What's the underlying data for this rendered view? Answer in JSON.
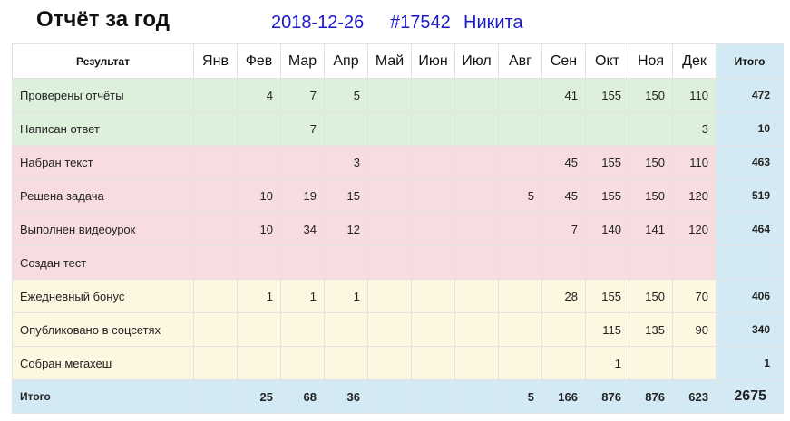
{
  "header": {
    "title": "Отчёт за год",
    "date": "2018-12-26",
    "id": "#17542",
    "user": "Никита"
  },
  "table": {
    "result_header": "Результат",
    "months": [
      "Янв",
      "Фев",
      "Мар",
      "Апр",
      "Май",
      "Июн",
      "Июл",
      "Авг",
      "Сен",
      "Окт",
      "Ноя",
      "Дек"
    ],
    "total_header": "Итого",
    "rows": [
      {
        "group": "green",
        "label": "Проверены отчёты",
        "values": [
          "",
          "4",
          "7",
          "5",
          "",
          "",
          "",
          "",
          "41",
          "155",
          "150",
          "110"
        ],
        "total": "472"
      },
      {
        "group": "green",
        "label": "Написан ответ",
        "values": [
          "",
          "",
          "7",
          "",
          "",
          "",
          "",
          "",
          "",
          "",
          "",
          "3"
        ],
        "total": "10"
      },
      {
        "group": "pink",
        "label": "Набран текст",
        "values": [
          "",
          "",
          "",
          "3",
          "",
          "",
          "",
          "",
          "45",
          "155",
          "150",
          "110"
        ],
        "total": "463"
      },
      {
        "group": "pink",
        "label": "Решена задача",
        "values": [
          "",
          "10",
          "19",
          "15",
          "",
          "",
          "",
          "5",
          "45",
          "155",
          "150",
          "120"
        ],
        "total": "519"
      },
      {
        "group": "pink",
        "label": "Выполнен видеоурок",
        "values": [
          "",
          "10",
          "34",
          "12",
          "",
          "",
          "",
          "",
          "7",
          "140",
          "141",
          "120"
        ],
        "total": "464"
      },
      {
        "group": "pink",
        "label": "Создан тест",
        "values": [
          "",
          "",
          "",
          "",
          "",
          "",
          "",
          "",
          "",
          "",
          "",
          ""
        ],
        "total": ""
      },
      {
        "group": "yellow",
        "label": "Ежедневный бонус",
        "values": [
          "",
          "1",
          "1",
          "1",
          "",
          "",
          "",
          "",
          "28",
          "155",
          "150",
          "70"
        ],
        "total": "406"
      },
      {
        "group": "yellow",
        "label": "Опубликовано в соцсетях",
        "values": [
          "",
          "",
          "",
          "",
          "",
          "",
          "",
          "",
          "",
          "115",
          "135",
          "90"
        ],
        "total": "340"
      },
      {
        "group": "yellow",
        "label": "Собран мегахеш",
        "values": [
          "",
          "",
          "",
          "",
          "",
          "",
          "",
          "",
          "",
          "1",
          "",
          ""
        ],
        "total": "1"
      }
    ],
    "footer": {
      "label": "Итого",
      "values": [
        "",
        "25",
        "68",
        "36",
        "",
        "",
        "",
        "5",
        "166",
        "876",
        "876",
        "623"
      ],
      "grand_total": "2675"
    }
  }
}
